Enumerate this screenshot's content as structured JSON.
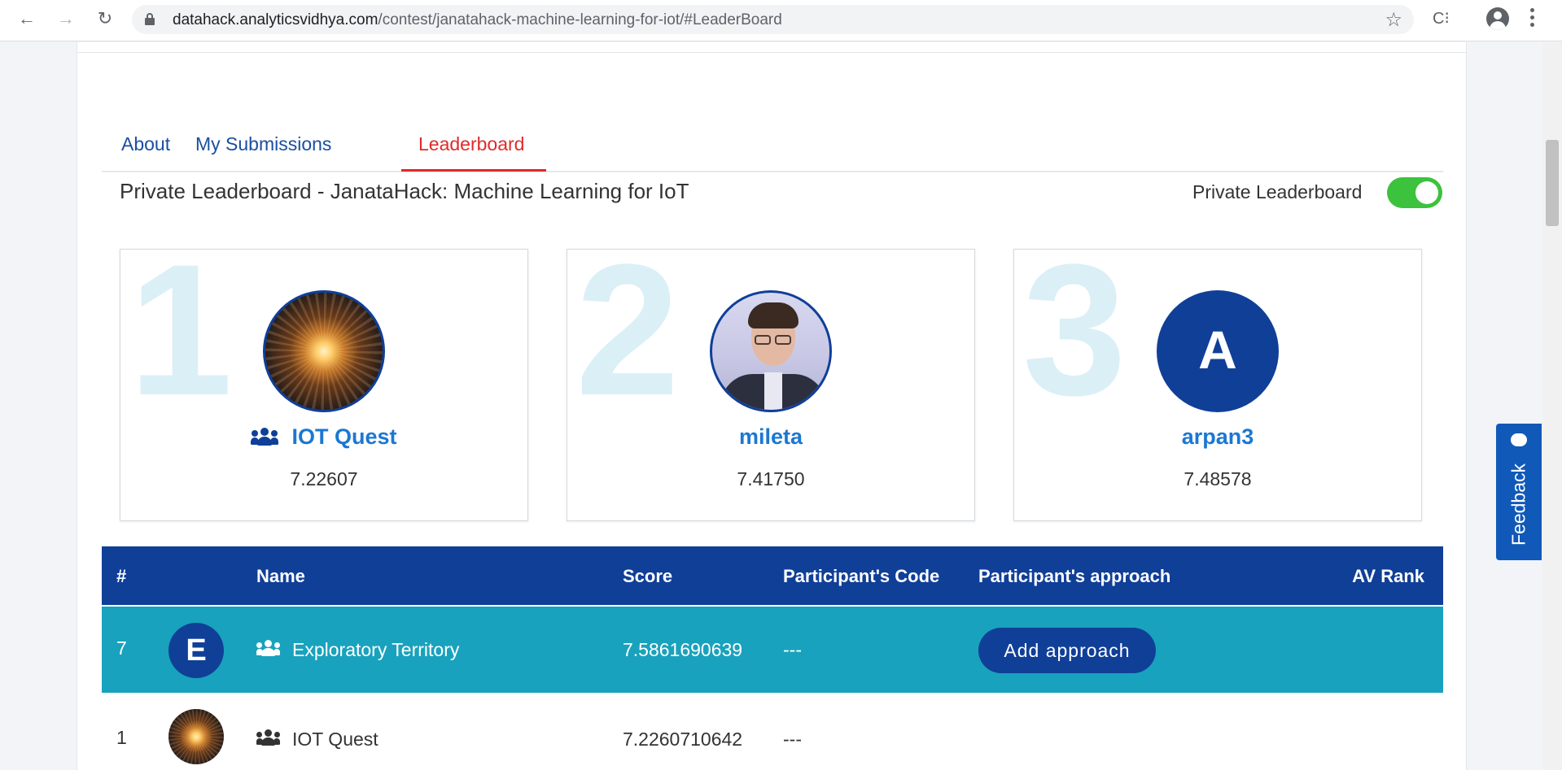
{
  "browser": {
    "url_domain": "datahack.analyticsvidhya.com",
    "url_path": "/contest/janatahack-machine-learning-for-iot/#LeaderBoard",
    "back_icon": "←",
    "forward_icon": "→",
    "reload_icon": "↻",
    "star_icon": "☆",
    "extension_icon": "C⁝"
  },
  "tabs": [
    {
      "label": "About"
    },
    {
      "label": "My Submissions"
    },
    {
      "label": "Leaderboard"
    }
  ],
  "leaderboard": {
    "title": "Private Leaderboard - JanataHack: Machine Learning for IoT",
    "toggle_label": "Private Leaderboard",
    "toggle_on": true
  },
  "podium": [
    {
      "rank": "1",
      "name": "IOT Quest",
      "score": "7.22607",
      "team": true
    },
    {
      "rank": "2",
      "name": "mileta",
      "score": "7.41750",
      "team": false
    },
    {
      "rank": "3",
      "name": "arpan3",
      "score": "7.48578",
      "avatar_letter": "A",
      "team": false
    }
  ],
  "table": {
    "headers": {
      "rank": "#",
      "name": "Name",
      "score": "Score",
      "code": "Participant's Code",
      "approach": "Participant's approach",
      "av_rank": "AV Rank"
    },
    "rows": [
      {
        "rank": "7",
        "avatar_letter": "E",
        "name": "Exploratory Territory",
        "score": "7.5861690639",
        "code": "---",
        "approach_button": "Add approach"
      },
      {
        "rank": "1",
        "name": "IOT Quest",
        "score": "7.2260710642",
        "code": "---"
      }
    ]
  },
  "feedback": {
    "label": "Feedback"
  },
  "colors": {
    "primary": "#103f98",
    "highlight_row": "#19a2bd",
    "active_tab": "#e12a2a",
    "toggle_on": "#3cc23c",
    "link": "#1b78d2"
  }
}
